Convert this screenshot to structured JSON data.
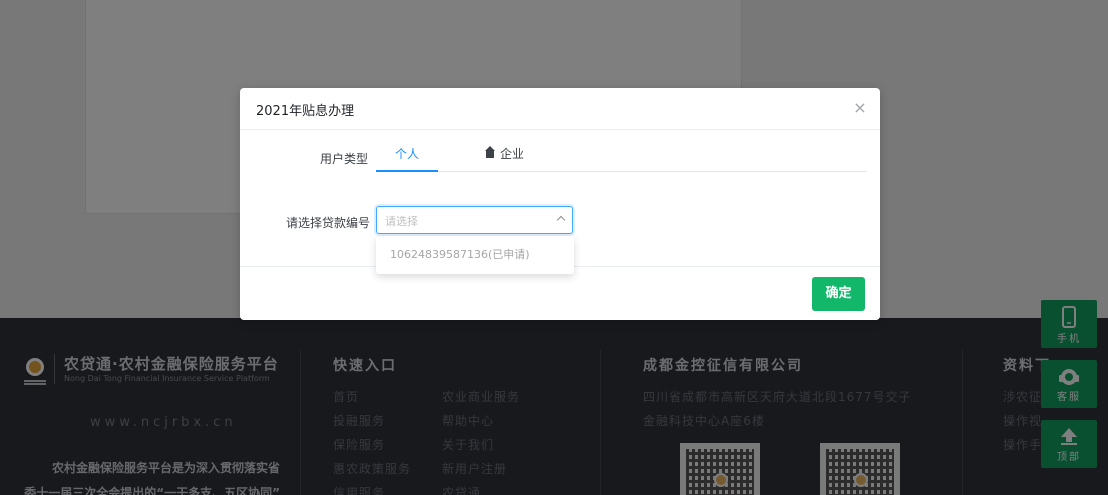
{
  "footer": {
    "brand_title": "农贷通·农村金融保险服务平台",
    "brand_en": "Nong Dai Tong Financial Insurance Service Platform",
    "website": "www.ncjrbx.cn",
    "intro_line1": "农村金融保险服务平台是为深入贯彻落实省",
    "intro_line2": "委十一届三次全会提出的“一干多支、五区协同”",
    "quick_title": "快速入口",
    "quick_links": [
      "首页",
      "农业商业服务",
      "投融服务",
      "帮助中心",
      "保险服务",
      "关于我们",
      "惠农政策服务",
      "新用户注册",
      "信用服务",
      "农贷通"
    ],
    "company_title": "成都金控征信有限公司",
    "company_addr1": "四川省成都市高新区天府大道北段1677号交子",
    "company_addr2": "金融科技中心A座6楼",
    "resources_title": "资料下",
    "resources_links": [
      "涉农征",
      "操作视",
      "操作手"
    ]
  },
  "side_buttons": [
    {
      "label": "手机",
      "icon": "phone-icon"
    },
    {
      "label": "客服",
      "icon": "headset-icon"
    },
    {
      "label": "顶部",
      "icon": "arrow-up-icon"
    }
  ],
  "dialog": {
    "title": "2021年贴息办理",
    "close_glyph": "×",
    "user_type_label": "用户类型",
    "tabs": [
      "个人",
      "企业"
    ],
    "loan_label": "请选择贷款编号",
    "select_placeholder": "请选择",
    "dropdown_options": [
      "10624839587136(已申请)"
    ],
    "ok_label": "确定"
  },
  "colors": {
    "primary": "#1890ff",
    "confirm_green": "#12b76a",
    "side_green": "#12a063",
    "footer_bg": "#31333b"
  }
}
